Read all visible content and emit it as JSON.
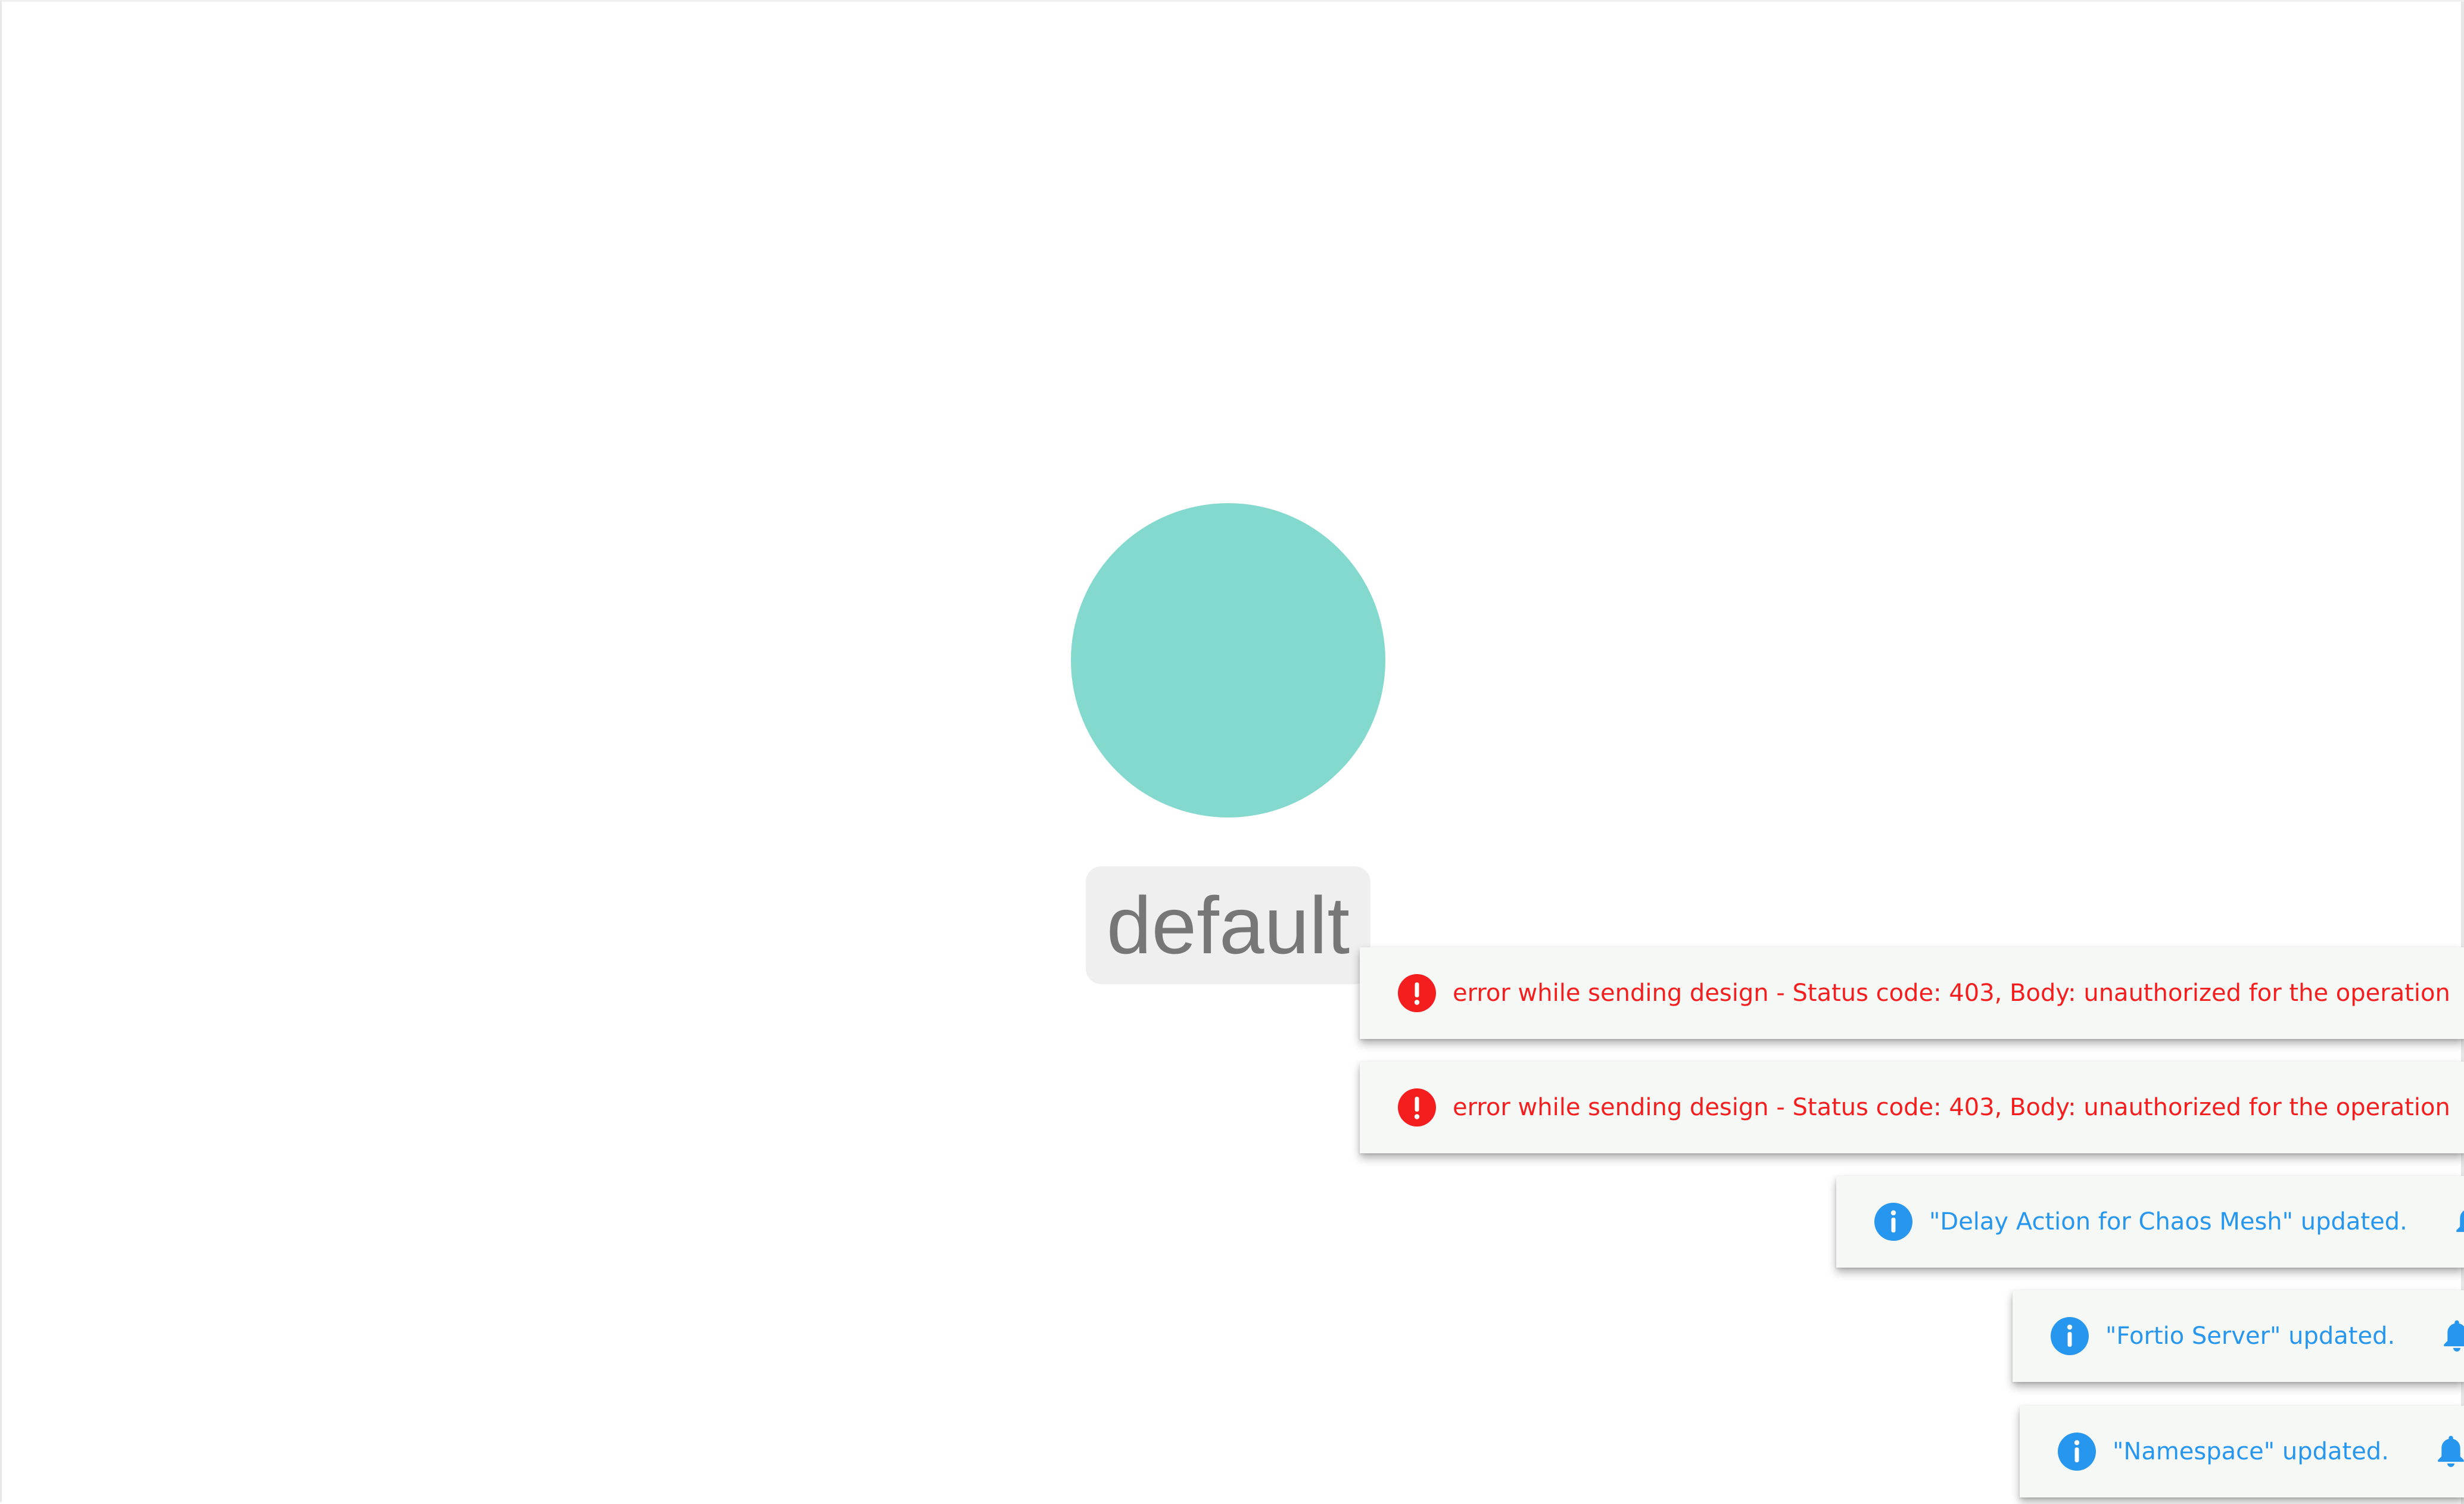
{
  "canvas": {
    "node": {
      "label": "default",
      "color": "#83d9ce"
    }
  },
  "notifications": [
    {
      "type": "error",
      "icon": "error-icon",
      "message": "error while sending design - Status code: 403, Body: unauthorized for the operation",
      "action_icon": "bell-icon",
      "color": "#f41e1e"
    },
    {
      "type": "error",
      "icon": "error-icon",
      "message": "error while sending design - Status code: 403, Body: unauthorized for the operation",
      "action_icon": "bell-icon",
      "color": "#f41e1e"
    },
    {
      "type": "info",
      "icon": "info-icon",
      "message": "\"Delay Action for Chaos Mesh\" updated.",
      "action_icon": "bell-icon",
      "color": "#2696ee"
    },
    {
      "type": "info",
      "icon": "info-icon",
      "message": "\"Fortio Server\" updated.",
      "action_icon": "bell-icon",
      "color": "#2696ee"
    },
    {
      "type": "info",
      "icon": "info-icon",
      "message": "\"Namespace\" updated.",
      "action_icon": "bell-icon",
      "color": "#2696ee"
    }
  ]
}
